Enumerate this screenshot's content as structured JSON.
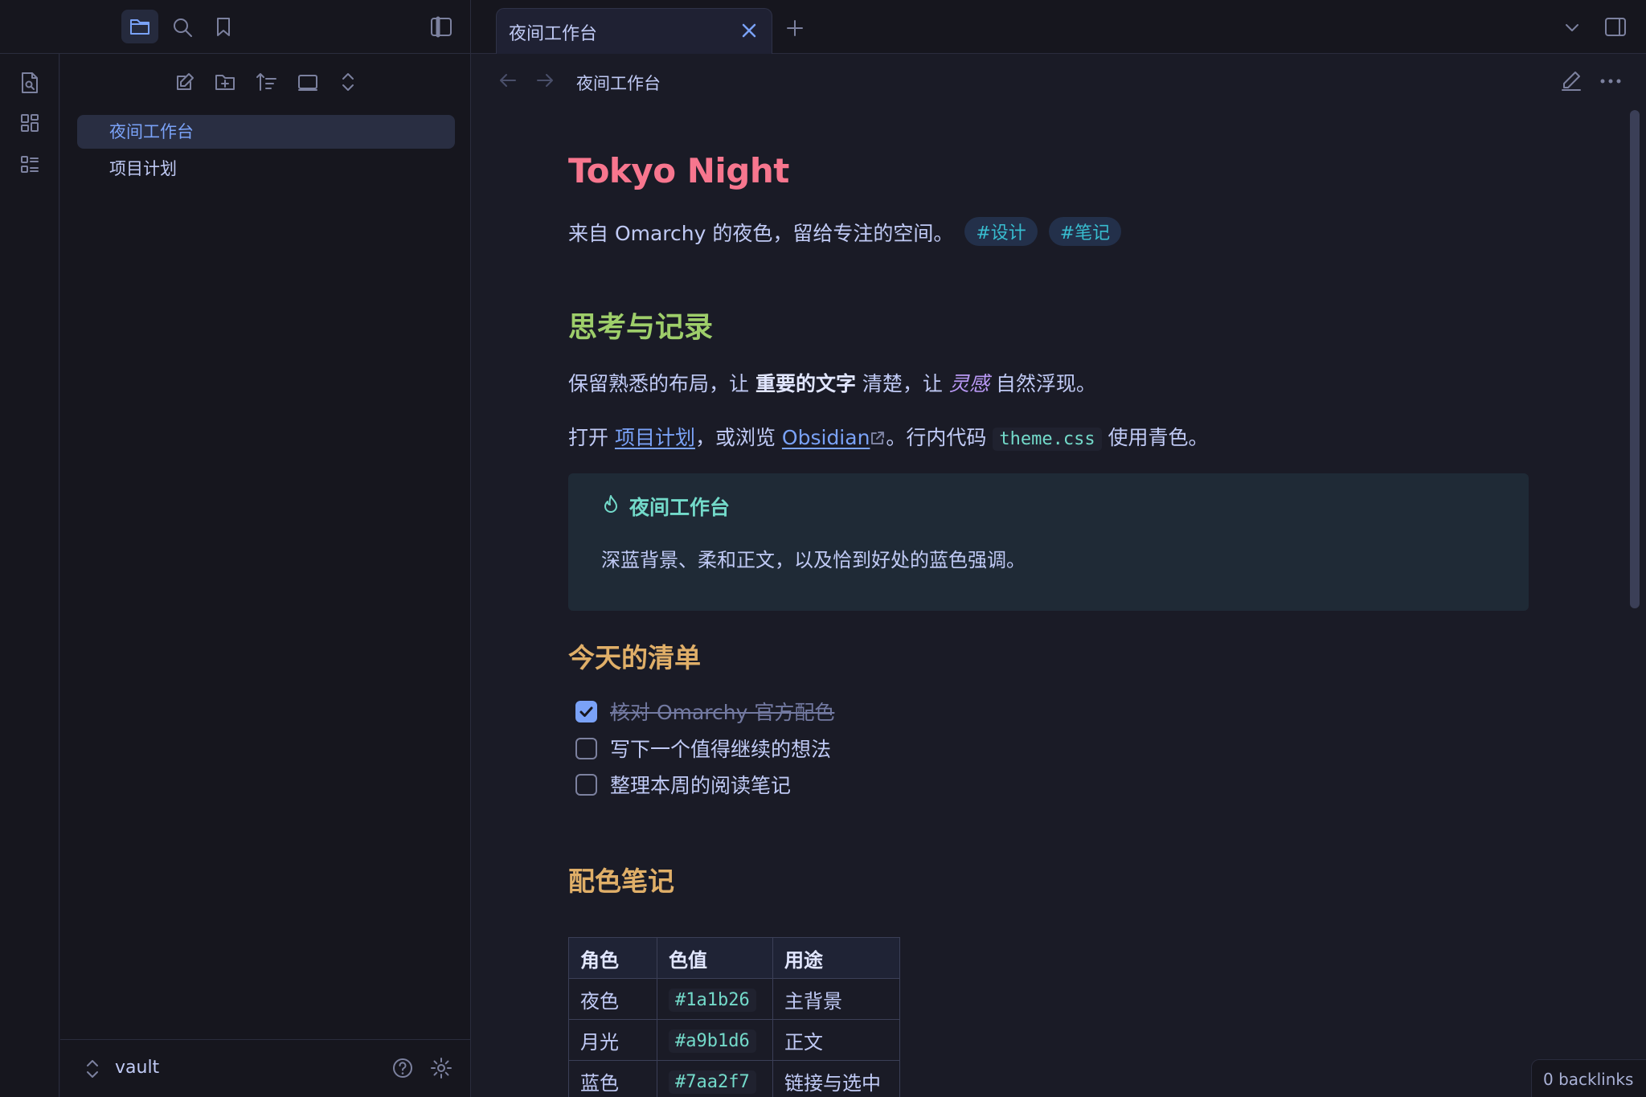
{
  "tabs": [
    {
      "label": "夜间工作台",
      "active": true
    }
  ],
  "breadcrumb": {
    "title": "夜间工作台"
  },
  "sidebar": {
    "files": [
      {
        "label": "夜间工作台",
        "active": true
      },
      {
        "label": "项目计划",
        "active": false
      }
    ],
    "vault": "vault"
  },
  "doc": {
    "title": "Tokyo Night",
    "intro": "来自 Omarchy 的夜色，留给专注的空间。",
    "tags": [
      "#设计",
      "#笔记"
    ],
    "h_think": "思考与记录",
    "p1": {
      "a": "保留熟悉的布局，让 ",
      "strong": "重要的文字",
      "b": " 清楚，让 ",
      "em": "灵感",
      "c": " 自然浮现。"
    },
    "p2": {
      "a": "打开 ",
      "link1": "项目计划",
      "b": "，或浏览 ",
      "link2": "Obsidian",
      "c": "。行内代码 ",
      "code": "theme.css",
      "d": " 使用青色。"
    },
    "callout": {
      "title": "夜间工作台",
      "body": "深蓝背景、柔和正文，以及恰到好处的蓝色强调。"
    },
    "h_today": "今天的清单",
    "tasks": [
      {
        "label": "核对 Omarchy 官方配色",
        "done": true
      },
      {
        "label": "写下一个值得继续的想法",
        "done": false
      },
      {
        "label": "整理本周的阅读笔记",
        "done": false
      }
    ],
    "h_colors": "配色笔记",
    "table": {
      "headers": [
        "角色",
        "色值",
        "用途"
      ],
      "rows": [
        [
          "夜色",
          "#1a1b26",
          "主背景"
        ],
        [
          "月光",
          "#a9b1d6",
          "正文"
        ],
        [
          "蓝色",
          "#7aa2f7",
          "链接与选中"
        ]
      ]
    }
  },
  "status": {
    "backlinks": "0 backlinks"
  },
  "colors": {
    "bg": "#1a1b26",
    "text": "#a9b1d6",
    "accent": "#7aa2f7",
    "title": "#f7768e",
    "green": "#9ece6a",
    "orange": "#e0af68",
    "cyan": "#73daca",
    "purple": "#bb9af7"
  }
}
